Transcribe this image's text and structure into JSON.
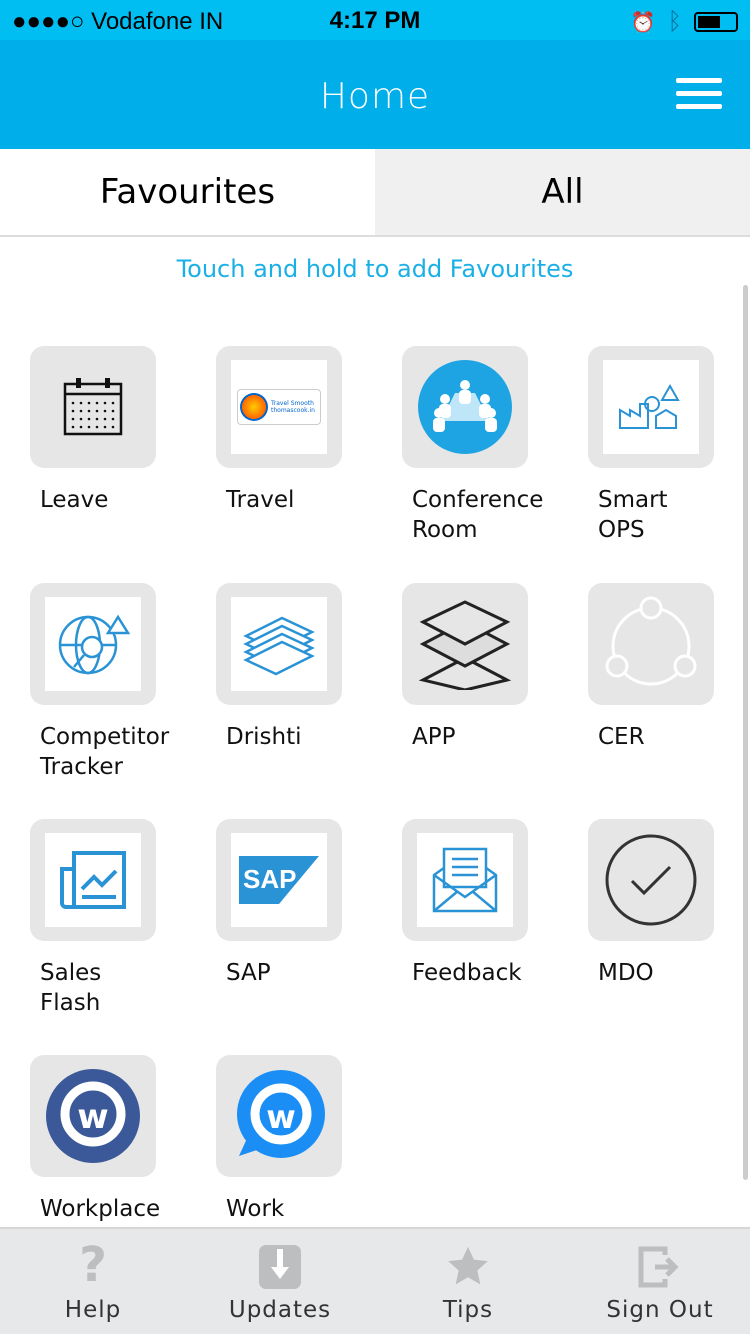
{
  "status_bar": {
    "carrier": "●●●●○ Vodafone IN",
    "time": "4:17 PM"
  },
  "header": {
    "title": "Home"
  },
  "tabs": [
    {
      "label": "Favourites",
      "selected": false
    },
    {
      "label": "All",
      "selected": true
    }
  ],
  "hint": "Touch and hold to add Favourites",
  "apps": [
    {
      "label": "Leave",
      "icon": "calendar-icon"
    },
    {
      "label": "Travel",
      "icon": "thomas-cook-logo",
      "logo_text": "Thomas Cook Travel Smooth thomascook.in"
    },
    {
      "label": "Conference\nRoom",
      "icon": "conference-icon"
    },
    {
      "label": "Smart\nOPS",
      "icon": "factory-alert-icon"
    },
    {
      "label": "Competitor\nTracker",
      "icon": "globe-search-icon"
    },
    {
      "label": "Drishti",
      "icon": "stack-icon"
    },
    {
      "label": "APP",
      "icon": "layers-icon"
    },
    {
      "label": "CER",
      "icon": "share-circle-icon"
    },
    {
      "label": "Sales\nFlash",
      "icon": "news-chart-icon"
    },
    {
      "label": "SAP",
      "icon": "sap-logo",
      "logo_text": "SAP"
    },
    {
      "label": "Feedback",
      "icon": "mail-icon"
    },
    {
      "label": "MDO",
      "icon": "check-circle-icon"
    },
    {
      "label": "Workplace",
      "icon": "workplace-icon"
    },
    {
      "label": "Work",
      "icon": "work-chat-icon"
    }
  ],
  "bottom_bar": [
    {
      "label": "Help",
      "icon": "question-icon"
    },
    {
      "label": "Updates",
      "icon": "download-icon"
    },
    {
      "label": "Tips",
      "icon": "star-icon"
    },
    {
      "label": "Sign Out",
      "icon": "sign-out-icon"
    }
  ],
  "colors": {
    "status": "#00bef1",
    "header": "#00aeea",
    "accent": "#1ab0e6",
    "icon_blue": "#2a93d5"
  }
}
